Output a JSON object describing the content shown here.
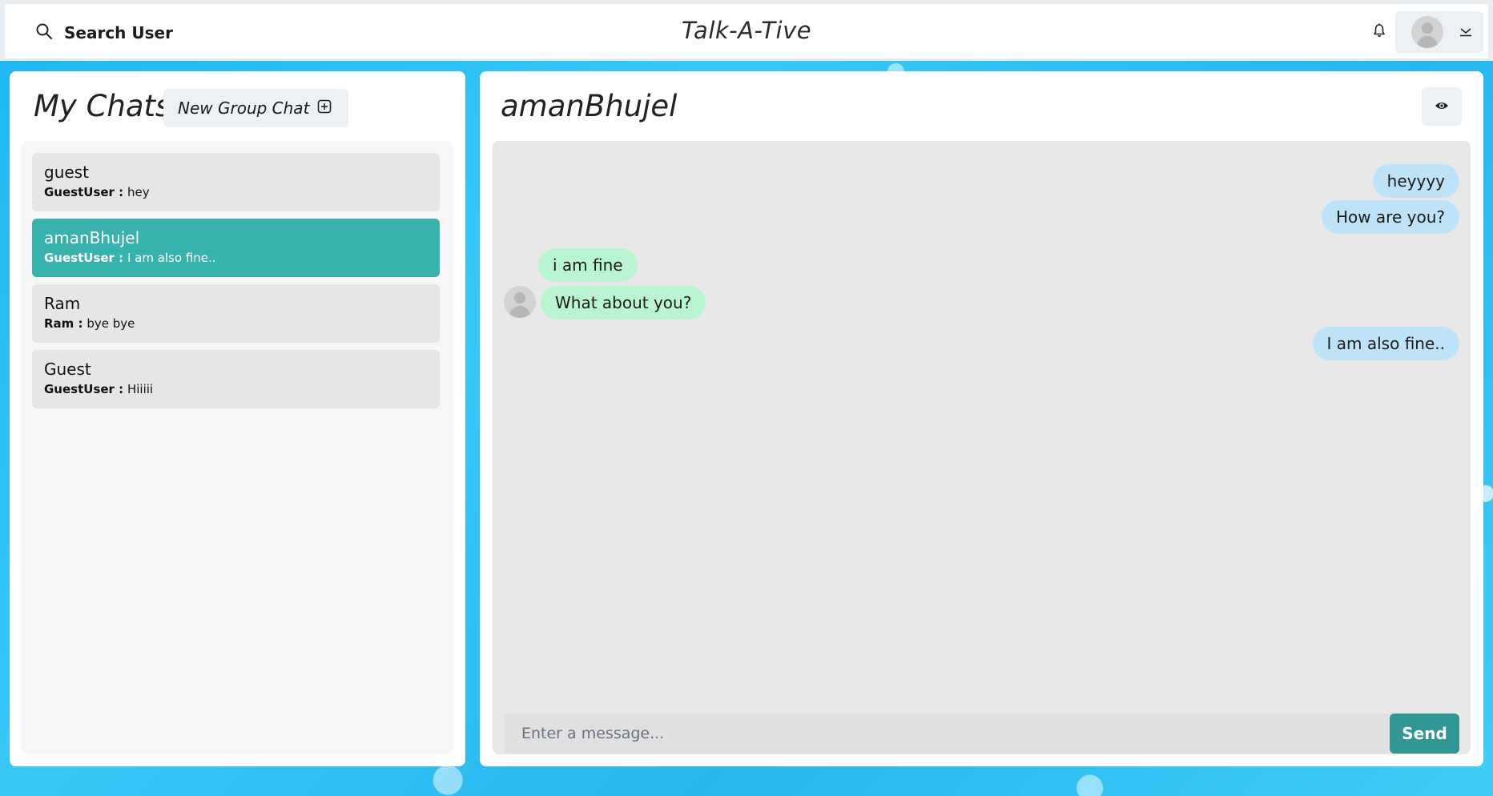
{
  "header": {
    "search_label": "Search User",
    "app_title": "Talk-A-Tive"
  },
  "sidebar": {
    "title": "My Chats",
    "new_group_label": "New Group Chat",
    "chats": [
      {
        "name": "guest",
        "sender": "GuestUser :",
        "preview": "hey",
        "active": false
      },
      {
        "name": "amanBhujel",
        "sender": "GuestUser :",
        "preview": "I am also fine..",
        "active": true
      },
      {
        "name": "Ram",
        "sender": "Ram :",
        "preview": "bye bye",
        "active": false
      },
      {
        "name": "Guest",
        "sender": "GuestUser :",
        "preview": "Hiiiii",
        "active": false
      }
    ]
  },
  "chat": {
    "title": "amanBhujel",
    "messages": [
      {
        "text": "heyyyy",
        "direction": "out"
      },
      {
        "text": "How are you?",
        "direction": "out"
      },
      {
        "text": "i am fine",
        "direction": "in"
      },
      {
        "text": "What about you?",
        "direction": "in"
      },
      {
        "text": "I am also fine..",
        "direction": "out"
      }
    ],
    "input_placeholder": "Enter a message...",
    "send_label": "Send"
  },
  "colors": {
    "active_chat": "#38b2ac",
    "outgoing_bubble": "#bee3f8",
    "incoming_bubble": "#b9f5d0",
    "send_button": "#319795"
  }
}
